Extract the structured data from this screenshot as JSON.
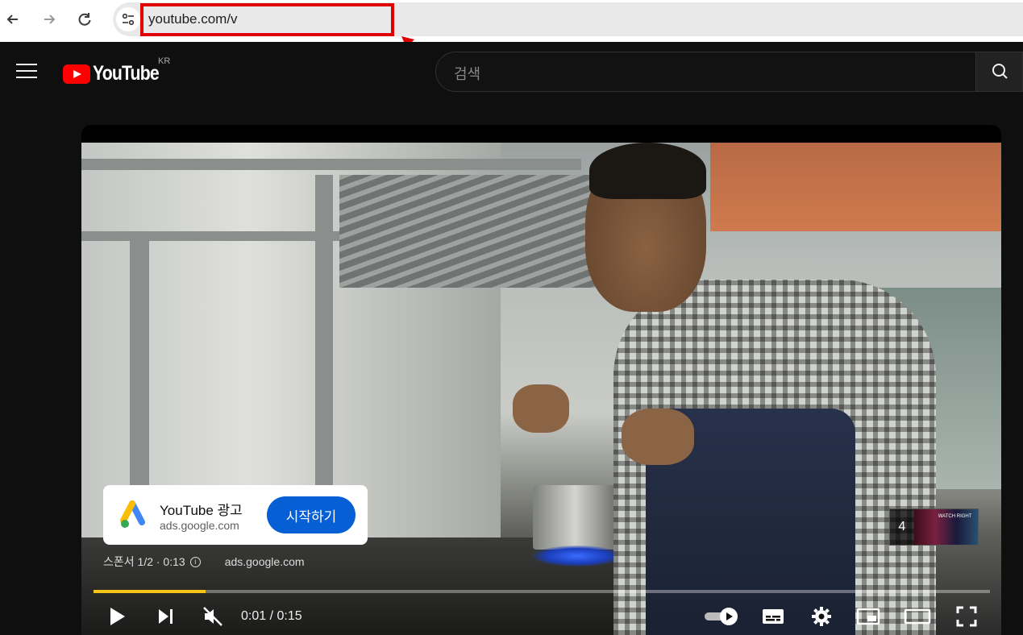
{
  "browser": {
    "url": "youtube.com/v",
    "back_icon": "arrow-left-icon",
    "forward_icon": "arrow-right-icon",
    "reload_icon": "reload-icon",
    "site_info_icon": "tune-icon",
    "highlight_color": "#e00000"
  },
  "header": {
    "logo_text": "YouTube",
    "region": "KR",
    "search_placeholder": "검색",
    "brand_color": "#ff0000"
  },
  "ad": {
    "title": "YouTube 광고",
    "url": "ads.google.com",
    "cta_label": "시작하기",
    "cta_color": "#065fd4",
    "sponsor_label": "스폰서 1/2 · 0:13",
    "sponsor_url": "ads.google.com"
  },
  "skip": {
    "count": "4",
    "thumb_text": "WATCH RIGHT"
  },
  "player": {
    "progress": 0.125,
    "progress_color": "#f5c518",
    "time": "0:01 / 0:15"
  }
}
